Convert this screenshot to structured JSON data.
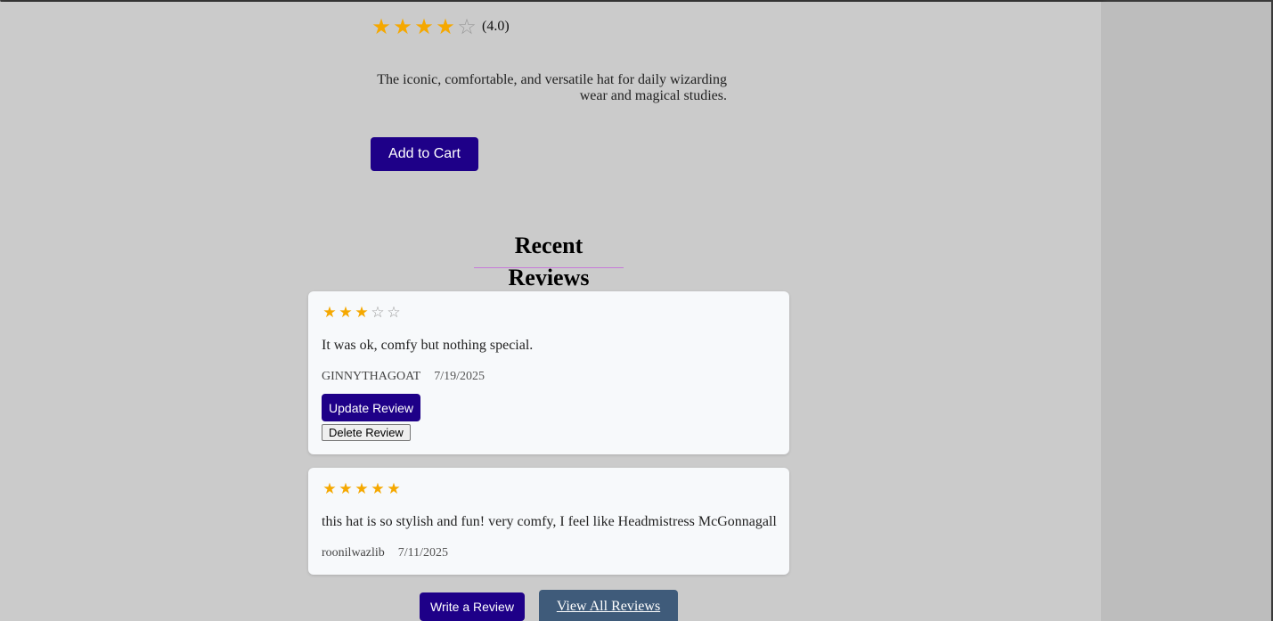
{
  "product": {
    "rating_stars": [
      "★",
      "★",
      "★",
      "★",
      "☆"
    ],
    "rating": 4.0,
    "rating_text": "(4.0)",
    "description": "The iconic, comfortable, and versatile hat for daily wizarding wear and magical studies.",
    "add_to_cart_label": "Add to Cart"
  },
  "reviews": {
    "title": "Recent Reviews",
    "items": [
      {
        "rating": 3,
        "stars": [
          "★",
          "★",
          "★",
          "☆",
          "☆"
        ],
        "text": "It was ok, comfy but nothing special.",
        "author": "GINNYTHAGOAT",
        "date": "7/19/2025",
        "update_label": "Update Review",
        "delete_label": "Delete Review"
      },
      {
        "rating": 5,
        "stars": [
          "★",
          "★",
          "★",
          "★",
          "★"
        ],
        "text": "this hat is so stylish and fun! very comfy, I feel like Headmistress McGonnagall",
        "author": "roonilwazlib",
        "date": "7/11/2025"
      }
    ],
    "write_label": "Write a Review",
    "view_all_label": "View All Reviews"
  },
  "colors": {
    "primary_button": "#1e0088",
    "view_all_button": "#3f5b7a",
    "star_filled": "#f5a800",
    "star_empty": "#9a9a9a",
    "title_underline": "#c77ad8"
  }
}
